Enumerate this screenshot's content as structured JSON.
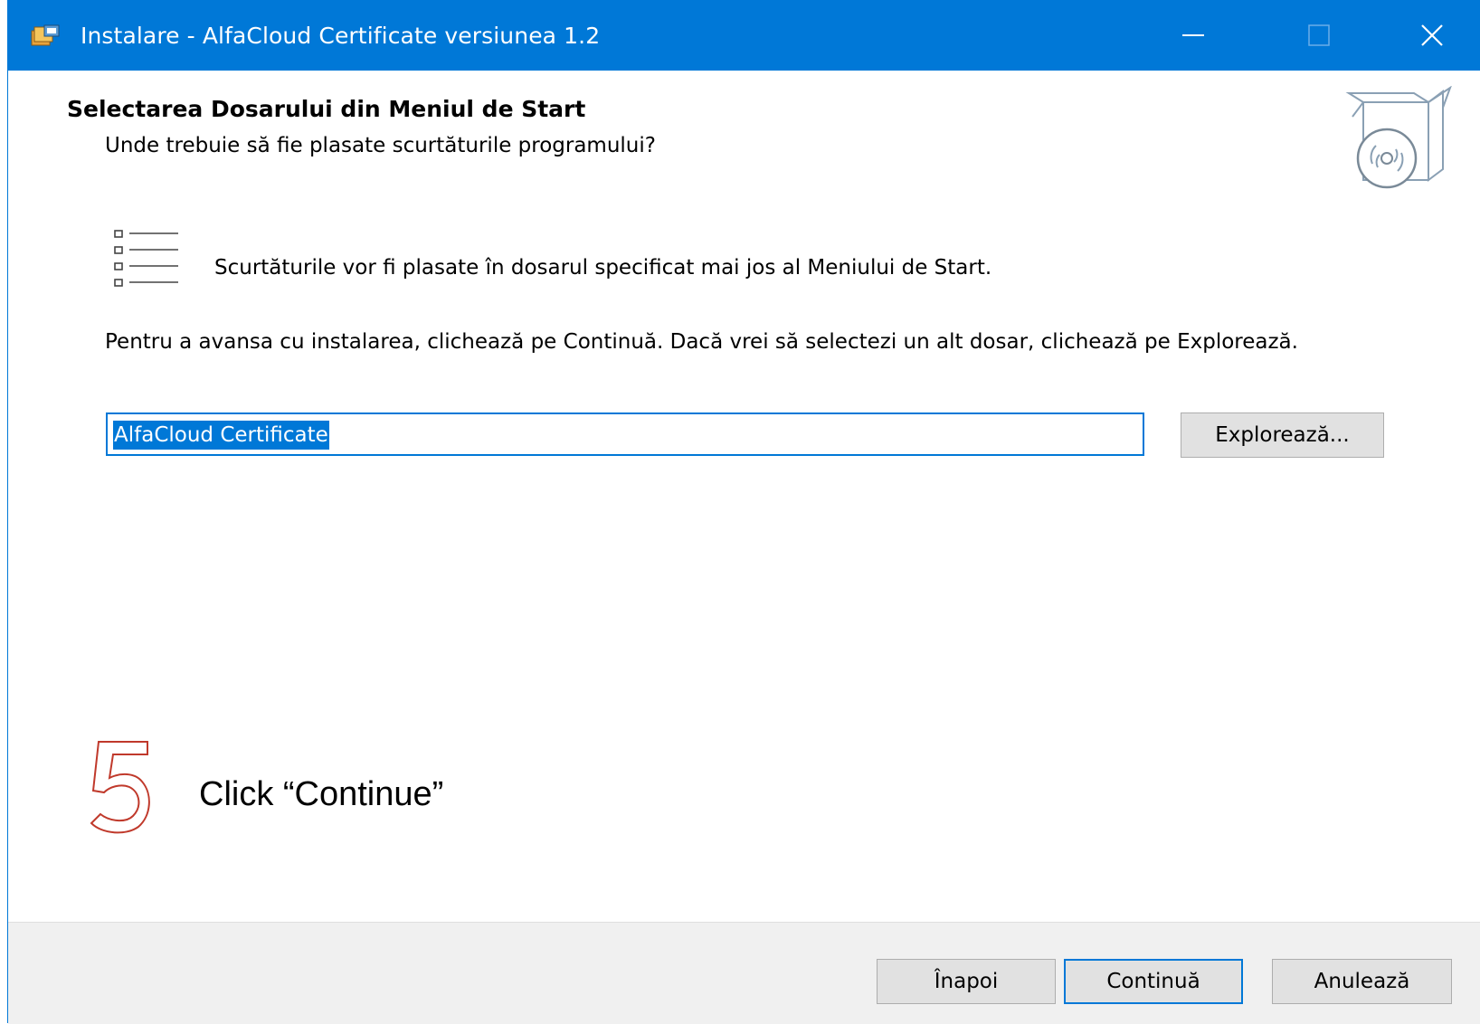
{
  "window": {
    "title": "Instalare - AlfaCloud Certificate versiunea 1.2",
    "accent_color": "#0078d7",
    "icons": {
      "app": "setup-app-icon",
      "minimize": "minimize-icon",
      "maximize": "maximize-icon",
      "close": "close-icon"
    }
  },
  "header": {
    "title": "Selectarea Dosarului din Meniul de Start",
    "subtitle": "Unde trebuie să fie plasate scurtăturile programului?",
    "graphic": "box-with-disc-icon"
  },
  "body": {
    "info_icon": "shortcut-list-icon",
    "info_text": "Scurtăturile vor fi plasate în dosarul specificat mai jos al Meniului de Start.",
    "instructions": "Pentru a avansa cu instalarea, clichează pe Continuă. Dacă vrei să selectezi un alt dosar, clichează pe Explorează.",
    "folder_value": "AlfaCloud Certificate",
    "browse_label": "Explorează..."
  },
  "annotation": {
    "step_number": "5",
    "step_color": "#c0392b",
    "caption": "Click “Continue”"
  },
  "footer": {
    "back_label": "Înapoi",
    "continue_label": "Continuă",
    "cancel_label": "Anulează"
  }
}
